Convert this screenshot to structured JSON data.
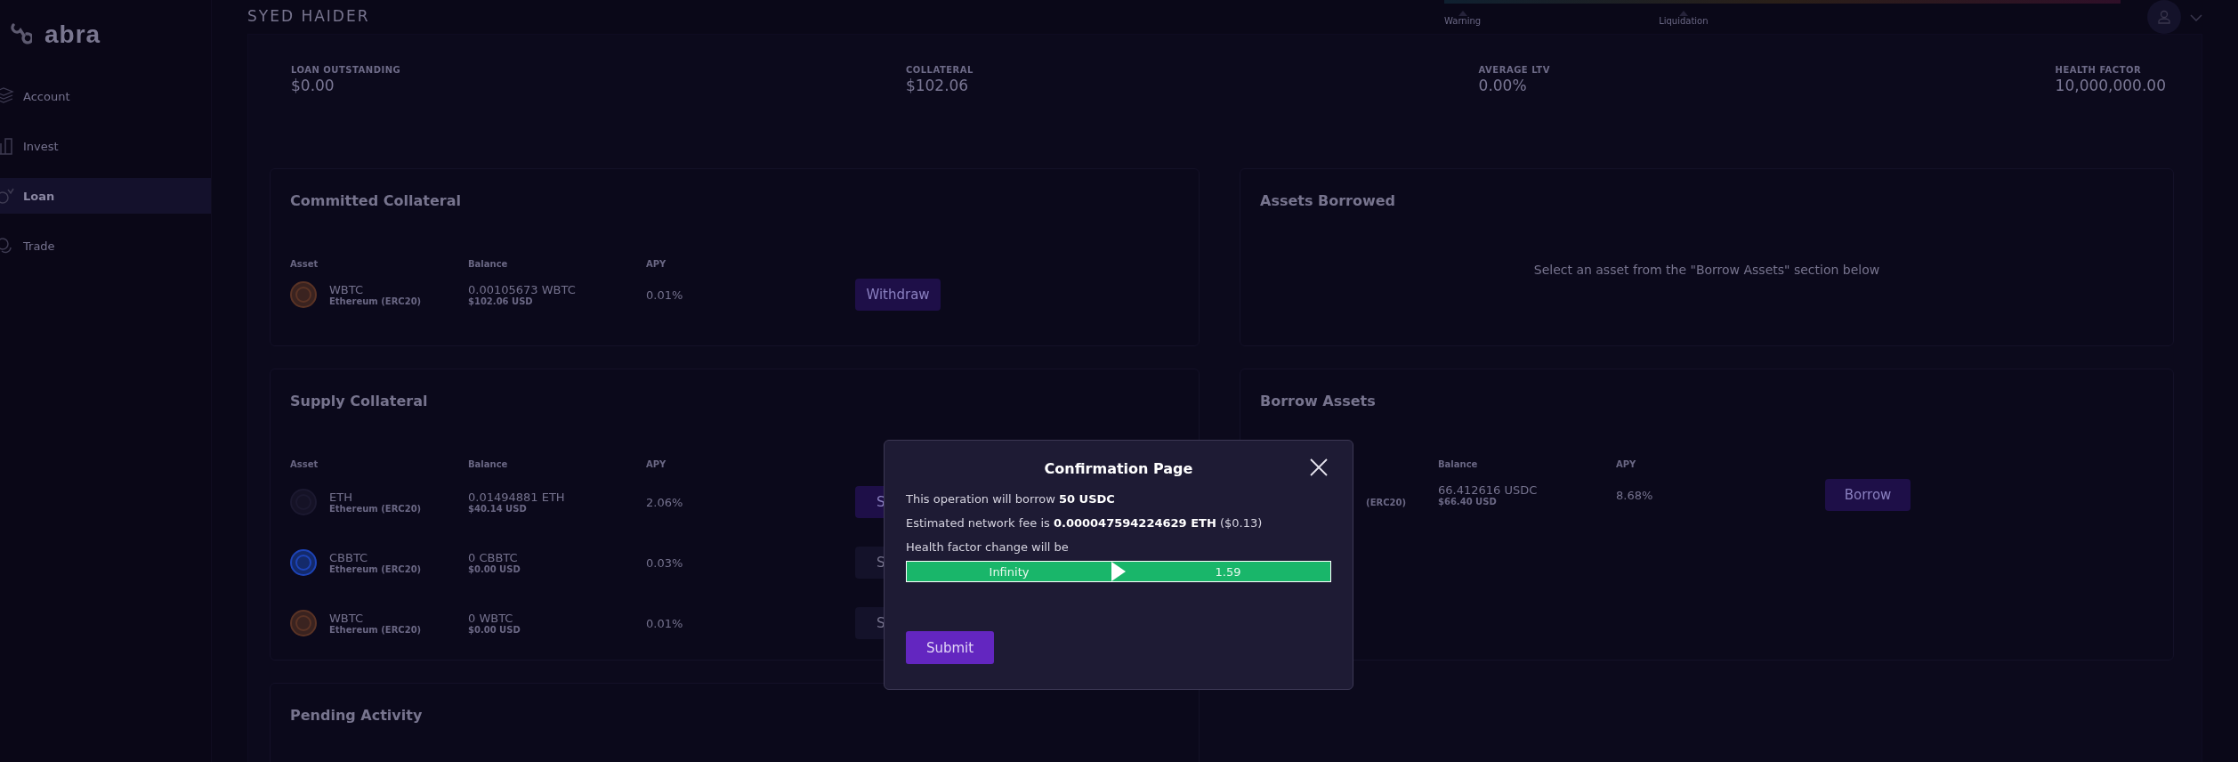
{
  "sidebar": {
    "logo": "abra",
    "items": [
      {
        "label": "Account",
        "kind": "account",
        "selected": false
      },
      {
        "label": "Invest",
        "kind": "invest",
        "selected": false
      },
      {
        "label": "Loan",
        "kind": "loan",
        "selected": true
      },
      {
        "label": "Trade",
        "kind": "trade",
        "selected": false
      }
    ]
  },
  "header": {
    "user": "SYED HAIDER",
    "gauge_labels": [
      "Warning",
      "Liquidation"
    ]
  },
  "stats": [
    {
      "label": "LOAN OUTSTANDING",
      "value": "$0.00"
    },
    {
      "label": "COLLATERAL",
      "value": "$102.06"
    },
    {
      "label": "AVERAGE LTV",
      "value": "0.00%"
    },
    {
      "label": "HEALTH FACTOR",
      "value": "10,000,000.00"
    }
  ],
  "committed": {
    "title": "Committed Collateral",
    "columns": [
      "Asset",
      "Balance",
      "APY"
    ],
    "rows": [
      {
        "kind": "wbtc",
        "asset": "WBTC",
        "network": "Ethereum (ERC20)",
        "balance": "0.00105673 WBTC",
        "balance_usd": "$102.06 USD",
        "apy": "0.01%",
        "action": "Withdraw"
      }
    ]
  },
  "supply": {
    "title": "Supply Collateral",
    "columns": [
      "Asset",
      "Balance",
      "APY"
    ],
    "rows": [
      {
        "kind": "eth",
        "asset": "ETH",
        "network": "Ethereum (ERC20)",
        "balance": "0.01494881 ETH",
        "balance_usd": "$40.14 USD",
        "apy": "2.06%",
        "action": "S",
        "action_active": true
      },
      {
        "kind": "cbbtc",
        "asset": "CBBTC",
        "network": "Ethereum (ERC20)",
        "balance": "0 CBBTC",
        "balance_usd": "$0.00 USD",
        "apy": "0.03%",
        "action": "S",
        "action_active": false
      },
      {
        "kind": "wbtc",
        "asset": "WBTC",
        "network": "Ethereum (ERC20)",
        "balance": "0 WBTC",
        "balance_usd": "$0.00 USD",
        "apy": "0.01%",
        "action": "S",
        "action_active": false
      }
    ]
  },
  "pending": {
    "title": "Pending Activity"
  },
  "borrowed": {
    "title": "Assets Borrowed",
    "message": "Select an asset from the \"Borrow Assets\" section below"
  },
  "borrow": {
    "title": "Borrow Assets",
    "columns": [
      "Balance",
      "APY"
    ],
    "rows": [
      {
        "network": "(ERC20)",
        "balance": "66.412616 USDC",
        "balance_usd": "$66.40 USD",
        "apy": "8.68%",
        "action": "Borrow"
      }
    ]
  },
  "modal": {
    "title": "Confirmation Page",
    "lines": [
      "This operation will borrow **50 USDC**",
      "Estimated network fee is **0.000047594224629 ETH** ($0.13)",
      "Health factor change will be"
    ],
    "health_from": "Infinity",
    "health_to": "1.59",
    "submit": "Submit"
  }
}
